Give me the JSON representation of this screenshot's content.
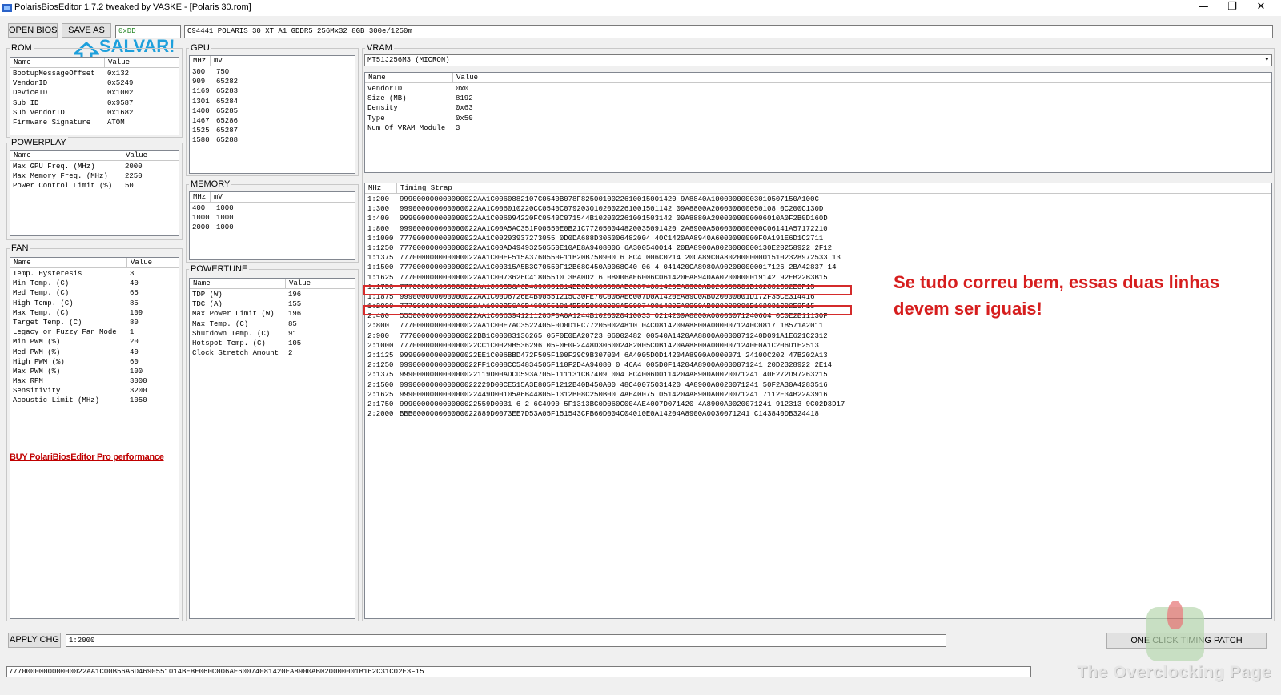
{
  "window": {
    "title": "PolarisBiosEditor 1.7.2 tweaked by VASKE - [Polaris 30.rom]",
    "minimize": "—",
    "restore": "❐",
    "close": "✕"
  },
  "toolbar": {
    "open_bios": "OPEN BIOS",
    "save_as": "SAVE AS",
    "checksum": "0xDD",
    "bios_name": "C94441 POLARIS 30 XT A1 GDDR5 256Mx32 8GB 300e/1250m"
  },
  "salvar_label": "SALVAR!",
  "rom": {
    "title": "ROM",
    "col_name": "Name",
    "col_value": "Value",
    "rows": [
      {
        "name": "BootupMessageOffset",
        "value": "0x132"
      },
      {
        "name": "VendorID",
        "value": "0x5249"
      },
      {
        "name": "DeviceID",
        "value": "0x1002"
      },
      {
        "name": "Sub ID",
        "value": "0x9587"
      },
      {
        "name": "Sub VendorID",
        "value": "0x1682"
      },
      {
        "name": "Firmware Signature",
        "value": "ATOM"
      }
    ]
  },
  "powerplay": {
    "title": "POWERPLAY",
    "col_name": "Name",
    "col_value": "Value",
    "rows": [
      {
        "name": "Max GPU Freq. (MHz)",
        "value": "2000"
      },
      {
        "name": "Max Memory Freq. (MHz)",
        "value": "2250"
      },
      {
        "name": "Power Control Limit (%)",
        "value": "50"
      }
    ]
  },
  "fan": {
    "title": "FAN",
    "col_name": "Name",
    "col_value": "Value",
    "rows": [
      {
        "name": "Temp. Hysteresis",
        "value": "3"
      },
      {
        "name": "Min Temp. (C)",
        "value": "40"
      },
      {
        "name": "Med Temp. (C)",
        "value": "65"
      },
      {
        "name": "High Temp. (C)",
        "value": "85"
      },
      {
        "name": "Max Temp. (C)",
        "value": "109"
      },
      {
        "name": "Target Temp. (C)",
        "value": "80"
      },
      {
        "name": "Legacy or Fuzzy Fan Mode",
        "value": "1"
      },
      {
        "name": "Min PWM (%)",
        "value": "20"
      },
      {
        "name": "Med PWM (%)",
        "value": "40"
      },
      {
        "name": "High PWM (%)",
        "value": "60"
      },
      {
        "name": "Max PWM (%)",
        "value": "100"
      },
      {
        "name": "Max RPM",
        "value": "3000"
      },
      {
        "name": "Sensitivity",
        "value": "3200"
      },
      {
        "name": "Acoustic Limit (MHz)",
        "value": "1050"
      }
    ]
  },
  "buy_link": "BUY PolariBiosEditor Pro performance",
  "gpu": {
    "title": "GPU",
    "col_a": "MHz",
    "col_b": "mV",
    "rows": [
      {
        "a": "300",
        "b": "750"
      },
      {
        "a": "909",
        "b": "65282"
      },
      {
        "a": "1169",
        "b": "65283"
      },
      {
        "a": "1301",
        "b": "65284"
      },
      {
        "a": "1400",
        "b": "65285"
      },
      {
        "a": "1467",
        "b": "65286"
      },
      {
        "a": "1525",
        "b": "65287"
      },
      {
        "a": "1580",
        "b": "65288"
      }
    ]
  },
  "memory": {
    "title": "MEMORY",
    "col_a": "MHz",
    "col_b": "mV",
    "rows": [
      {
        "a": "400",
        "b": "1000"
      },
      {
        "a": "1000",
        "b": "1000"
      },
      {
        "a": "2000",
        "b": "1000"
      }
    ]
  },
  "powertune": {
    "title": "POWERTUNE",
    "col_name": "Name",
    "col_value": "Value",
    "rows": [
      {
        "name": "TDP (W)",
        "value": "196"
      },
      {
        "name": "TDC (A)",
        "value": "155"
      },
      {
        "name": "Max Power Limit (W)",
        "value": "196"
      },
      {
        "name": "Max Temp. (C)",
        "value": "85"
      },
      {
        "name": "Shutdown Temp. (C)",
        "value": "91"
      },
      {
        "name": "Hotspot Temp. (C)",
        "value": "105"
      },
      {
        "name": "Clock Stretch Amount",
        "value": "2"
      }
    ]
  },
  "vram": {
    "title": "VRAM",
    "selected": "MT51J256M3 (MICRON)",
    "dropdown_arrow": "▾",
    "col_name": "Name",
    "col_value": "Value",
    "rows": [
      {
        "name": "VendorID",
        "value": "0x0"
      },
      {
        "name": "Size (MB)",
        "value": "8192"
      },
      {
        "name": "Density",
        "value": "0x63"
      },
      {
        "name": "Type",
        "value": "0x50"
      },
      {
        "name": "Num Of VRAM Module",
        "value": "3"
      }
    ]
  },
  "timings": {
    "col_mhz": "MHz",
    "col_strap": "Timing Strap",
    "rows": [
      {
        "mhz": "1:200",
        "strap": "999000000000000022AA1C0060882107C0540B078F8250010022610015001420 9A8840A10000000003010507150A100C"
      },
      {
        "mhz": "1:300",
        "strap": "999000000000000022AA1C006010220CC0540C0792030102002261001501142 09A8800A200000000050108 0C200C130D"
      },
      {
        "mhz": "1:400",
        "strap": "999000000000000022AA1C006094220FC0540C071544B102002261001503142 09A8880A2000000000006010A0F2B0D160D"
      },
      {
        "mhz": "1:800",
        "strap": "999000000000000022AA1C00A5AC351F00550E0B21C772050044820035091420 2A8900A500000000000C06141A57172210"
      },
      {
        "mhz": "1:1000",
        "strap": "777000000000000022AA1C00293937273055 0D0DA688D306006482004 40C1420AA8940A6000000000F0A191E6D1C2711"
      },
      {
        "mhz": "1:1250",
        "strap": "777000000000000022AA1C00AD49493250550E10AE8A9408006 6A300540014 20BA8900A8020000000130E20258922 2F12"
      },
      {
        "mhz": "1:1375",
        "strap": "777000000000000022AA1C00EF515A3760550F11B20B750900 6 8C4 006C0214 20CA89C0A802000000015102328972533 13"
      },
      {
        "mhz": "1:1500",
        "strap": "777000000000000022AA1C00315A5B3C70550F12B68C450A0068C40 06 4 041420CA8980A902000000017126 2BA42837 14"
      },
      {
        "mhz": "1:1625",
        "strap": "777000000000000022AA1C0073626C41805510 3BA0D2 6 0B006AE6006C061420EA8940AA0200000019142 92EB22B3B15"
      },
      {
        "mhz": "1:1750",
        "strap": "777000000000000022AA1C00B56A6D4690551014BE8E060C006AE60074081420EA8900AB020000001B162C31C02E3F15"
      },
      {
        "mhz": "1:1875",
        "strap": "999000000000000022AA1C00D6726E4B90551215C30FE70C006AE6007D0A1420EA89C0AB020000001D172F35CE314416"
      },
      {
        "mhz": "1:2000",
        "strap": "777000000000000022AA1C00B56A6D4690551014BE8E060C006AE60074081420EA8900AB020000001B162C31C02E3F15"
      },
      {
        "mhz": "2:400",
        "strap": "555000000000000022AA1C0063941211205F0A0A1244B1020020410033 0214209A8800A00000071240604 0C0E2B11130F"
      },
      {
        "mhz": "2:800",
        "strap": "777000000000000022AA1C00E7AC3522405F0D0D1FC772050024810 04C0814209A8800A0000071240C0817 1B571A2011"
      },
      {
        "mhz": "2:900",
        "strap": "777000000000000022BB1C00083136265 05F0E0EA20723 06002482 00540A1420AA8800A0000071240D091A1E621C2312"
      },
      {
        "mhz": "2:1000",
        "strap": "777000000000000022CC1C0029B536296 05F0E0F2448D306002482005C0B1420AA8800A0000071240E0A1C206D1E2513"
      },
      {
        "mhz": "2:1125",
        "strap": "999000000000000022EE1C006BBD472F505F100F29C9B307004 6A4005D0D14204A8900A0000071 24100C202 47B202A13"
      },
      {
        "mhz": "2:1250",
        "strap": "999000000000000022FF1C008CC54834505F110F2D4A94080 0 46A4 005D0F14204A8900A0000071241 20D2328922 2E14"
      },
      {
        "mhz": "2:1375",
        "strap": "999000000000000022119D00ADCD593A705F111131CB7409 004 8C4006D0114204A8900A0020071241 40E272D97263215"
      },
      {
        "mhz": "2:1500",
        "strap": "999000000000000022229D00CE515A3E805F1212B40B450A00 48C40075031420 4A8900A0020071241 50F2A30A4283516"
      },
      {
        "mhz": "2:1625",
        "strap": "999000000000000022449D00105A6B44805F1312B08C250B00 4AE40075 0514204A8900A0020071241 7112E34B22A3916"
      },
      {
        "mhz": "2:1750",
        "strap": "999000000000000022559D0031 6 2 6C4990 5F1313BC0D060C004AE4007D071420 4A8900A0020071241 912313 9C02D3D17"
      },
      {
        "mhz": "2:2000",
        "strap": "BBB000000000000022889D0073EE7D53A05F151543CFB60D004C04010E0A14204A8900A0030071241 C143840DB324418"
      }
    ]
  },
  "annotation": "Se tudo correu bem, essas duas linhas devem ser iguais!",
  "bottom": {
    "apply_chg": "APPLY CHG",
    "selected_strap_id": "1:2000",
    "one_click_patch": "ONE CLICK TIMING PATCH",
    "status_strap": "777000000000000022AA1C00B56A6D4690551014BE8E060C006AE60074081420EA8900AB020000001B162C31C02E3F15"
  },
  "watermark": "The Overclocking Page",
  "colors": {
    "accent_blue": "#1ea0dc",
    "annotation_red": "#d61e1e",
    "link_red": "#c00000"
  }
}
